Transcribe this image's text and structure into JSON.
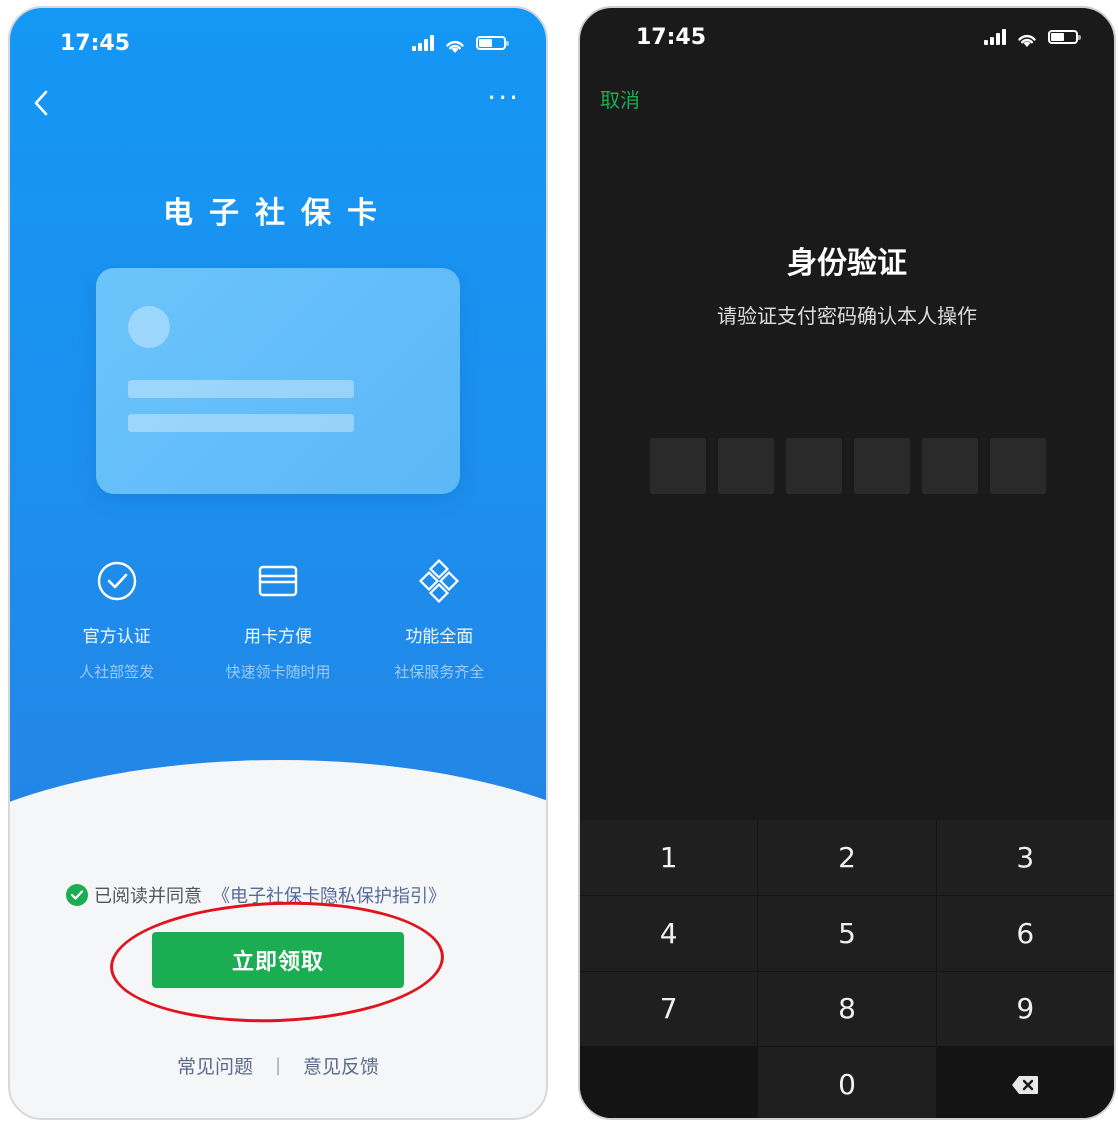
{
  "left_phone": {
    "status_time": "17:45",
    "title": "电子社保卡",
    "features": [
      {
        "icon": "badge-check-icon",
        "title": "官方认证",
        "subtitle": "人社部签发"
      },
      {
        "icon": "card-icon",
        "title": "用卡方便",
        "subtitle": "快速领卡随时用"
      },
      {
        "icon": "diamond-grid-icon",
        "title": "功能全面",
        "subtitle": "社保服务齐全"
      }
    ],
    "agreement_text": "已阅读并同意",
    "agreement_link": "《电子社保卡隐私保护指引》",
    "claim_button": "立即领取",
    "footer_links": [
      "常见问题",
      "意见反馈"
    ],
    "footer_separator": "|",
    "more_label": "···"
  },
  "right_phone": {
    "status_time": "17:45",
    "cancel_label": "取消",
    "verify_title": "身份验证",
    "verify_subtitle": "请验证支付密码确认本人操作",
    "pin_length": 6,
    "keypad": [
      "1",
      "2",
      "3",
      "4",
      "5",
      "6",
      "7",
      "8",
      "9",
      "",
      "0",
      "⌫"
    ]
  },
  "colors": {
    "primary_blue": "#1497f5",
    "wechat_green": "#1aad52",
    "annotation_red": "#e0141e",
    "dark_bg": "#1a1a1a"
  }
}
